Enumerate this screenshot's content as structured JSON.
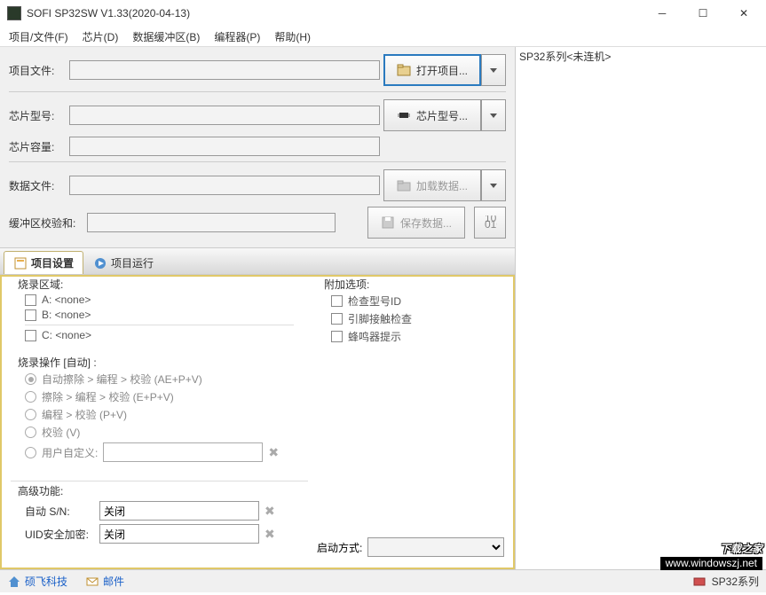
{
  "window": {
    "title": "SOFI SP32SW V1.33(2020-04-13)"
  },
  "menu": {
    "items": [
      "项目/文件(F)",
      "芯片(D)",
      "数据缓冲区(B)",
      "编程器(P)",
      "帮助(H)"
    ]
  },
  "form": {
    "project_file_label": "项目文件:",
    "chip_model_label": "芯片型号:",
    "chip_capacity_label": "芯片容量:",
    "data_file_label": "数据文件:",
    "checksum_label": "缓冲区校验和:",
    "open_project_btn": "打开项目...",
    "chip_model_btn": "芯片型号...",
    "load_data_btn": "加载数据...",
    "save_data_btn": "保存数据..."
  },
  "tabs": {
    "settings": "项目设置",
    "run": "项目运行"
  },
  "burn_area": {
    "title": "烧录区域:",
    "a": "A: <none>",
    "b": "B: <none>",
    "c": "C: <none>"
  },
  "extra_options": {
    "title": "附加选项:",
    "check_id": "检查型号ID",
    "pin_check": "引脚接触检查",
    "buzzer": "蜂鸣器提示"
  },
  "burn_op": {
    "title": "烧录操作 [自动] :",
    "r1": "自动擦除 > 编程 > 校验 (AE+P+V)",
    "r2": "擦除 > 编程 > 校验 (E+P+V)",
    "r3": "编程 > 校验 (P+V)",
    "r4": "校验 (V)",
    "r5": "用户自定义:"
  },
  "advanced": {
    "title": "高级功能:",
    "sn_label": "自动 S/N:",
    "sn_value": "关闭",
    "uid_label": "UID安全加密:",
    "uid_value": "关闭"
  },
  "startup": {
    "label": "启动方式:"
  },
  "right": {
    "status": "SP32系列<未连机>"
  },
  "status": {
    "link1": "硕飞科技",
    "link2": "邮件",
    "programmer": "SP32系列"
  },
  "watermark": {
    "big": "下载之家",
    "url": "www.windowszj.net"
  }
}
